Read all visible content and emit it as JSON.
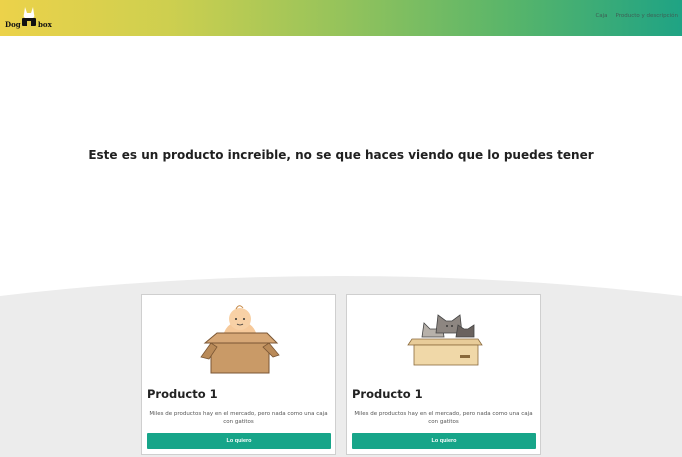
{
  "header": {
    "logo": {
      "word_left": "Dog",
      "word_right": "box"
    },
    "nav": [
      {
        "label": "Caja"
      },
      {
        "label": "Producto y descripción"
      }
    ]
  },
  "hero": {
    "title": "Este es un producto increible, no se que haces viendo que lo puedes tener"
  },
  "products": [
    {
      "image": "baby-in-box-illustration",
      "title": "Producto 1",
      "description": "Miles de productos hay en el mercado, pero nada como una caja con gatitos",
      "button_label": "Lo quiero"
    },
    {
      "image": "cats-in-box-illustration",
      "title": "Producto 1",
      "description": "Miles de productos hay en el mercado, pero nada como una caja con gatitos",
      "button_label": "Lo quiero"
    }
  ],
  "colors": {
    "header_gradient": [
      "#ecd24a",
      "#95c35b",
      "#1fa384"
    ],
    "button": "#17a589",
    "wave": "#ececec"
  }
}
